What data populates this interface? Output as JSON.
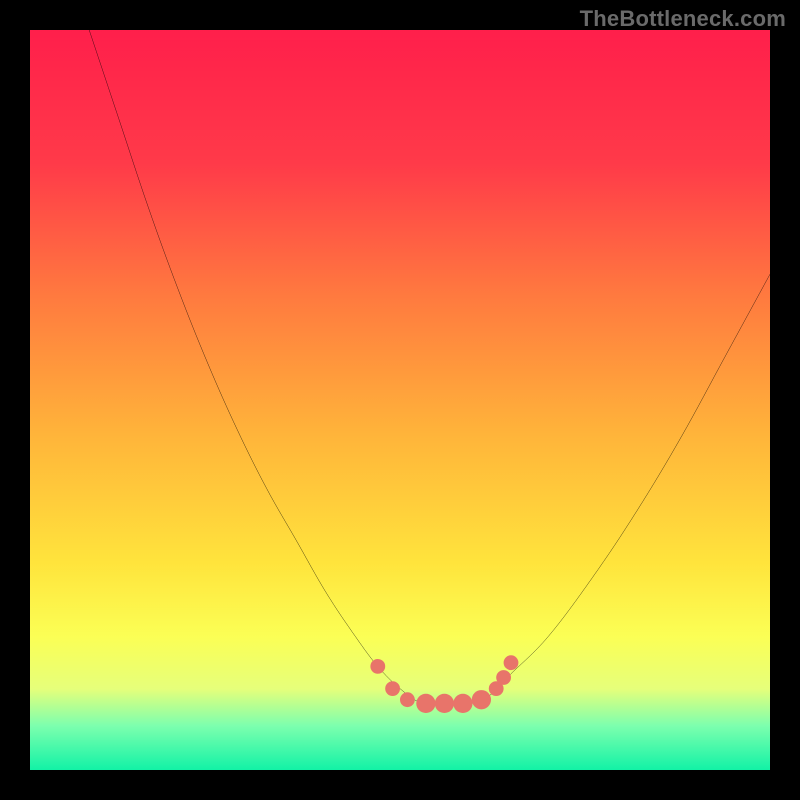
{
  "watermark": "TheBottleneck.com",
  "colors": {
    "frame": "#000000",
    "watermark_text": "#6a6a6a",
    "curve_stroke": "#000000",
    "dot_fill": "#e8746a",
    "gradient_stops": [
      {
        "offset": "0%",
        "color": "#ff1f4b"
      },
      {
        "offset": "18%",
        "color": "#ff3a49"
      },
      {
        "offset": "36%",
        "color": "#ff7a3f"
      },
      {
        "offset": "55%",
        "color": "#ffb53a"
      },
      {
        "offset": "72%",
        "color": "#ffe43c"
      },
      {
        "offset": "82%",
        "color": "#fbff55"
      },
      {
        "offset": "89%",
        "color": "#e6ff7a"
      },
      {
        "offset": "94%",
        "color": "#7dffae"
      },
      {
        "offset": "100%",
        "color": "#12f2a6"
      }
    ]
  },
  "chart_data": {
    "type": "line",
    "title": "",
    "xlabel": "",
    "ylabel": "",
    "xlim": [
      0,
      100
    ],
    "ylim": [
      0,
      100
    ],
    "grid": false,
    "legend": false,
    "note": "y increases downward visually; values are vertical position in % (0 = top). The valley near y≈91 corresponds to the best (green) region.",
    "series": [
      {
        "name": "bottleneck-curve",
        "x": [
          8,
          12,
          16,
          20,
          24,
          28,
          32,
          36,
          40,
          44,
          47,
          50,
          53,
          56,
          59,
          62,
          65,
          70,
          76,
          82,
          88,
          94,
          100
        ],
        "y": [
          0,
          12,
          24,
          35,
          45,
          54,
          62,
          69,
          76,
          82,
          86,
          89,
          91,
          91,
          91,
          90,
          87,
          82,
          74,
          65,
          55,
          44,
          33
        ]
      }
    ],
    "markers": {
      "name": "valley-dots",
      "x": [
        47,
        49,
        51,
        53.5,
        56,
        58.5,
        61,
        63,
        64,
        65
      ],
      "y": [
        86,
        89,
        90.5,
        91,
        91,
        91,
        90.5,
        89,
        87.5,
        85.5
      ],
      "r": [
        1.0,
        1.0,
        1.0,
        1.3,
        1.3,
        1.3,
        1.3,
        1.0,
        1.0,
        1.0
      ]
    }
  }
}
